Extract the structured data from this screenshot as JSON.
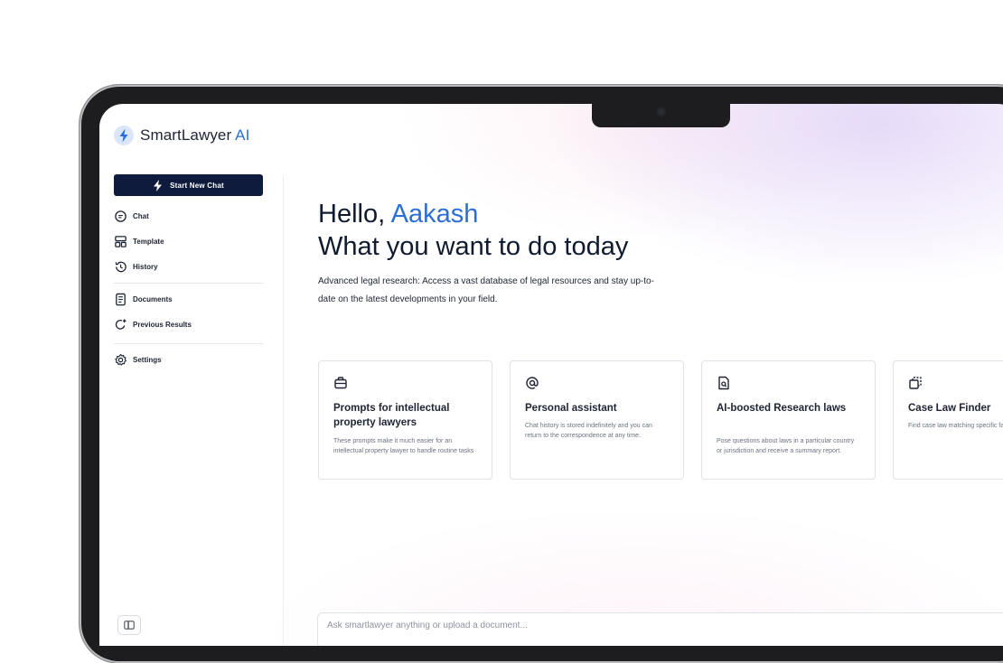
{
  "app": {
    "name_main": "SmartLawyer",
    "name_accent": "AI",
    "accent_color": "#2b6fd6",
    "primary_color": "#0e1b3d"
  },
  "sidebar": {
    "new_chat_label": "Start New Chat",
    "items": [
      {
        "label": "Chat",
        "icon": "chat-icon"
      },
      {
        "label": "Template",
        "icon": "template-icon"
      },
      {
        "label": "History",
        "icon": "history-icon"
      },
      {
        "label": "Documents",
        "icon": "document-icon"
      },
      {
        "label": "Previous Results",
        "icon": "refresh-sparkle-icon"
      },
      {
        "label": "Settings",
        "icon": "gear-icon"
      }
    ]
  },
  "main": {
    "greeting_prefix": "Hello, ",
    "user_name": "Aakash",
    "headline": "What you want to do today",
    "description": "Advanced legal research: Access a vast database of legal resources and stay up-to-date on the latest developments in your field.",
    "cards": [
      {
        "icon": "briefcase-icon",
        "title": "Prompts for intellectual property lawyers",
        "desc": "These prompts make it much easier for an intellectual property lawyer to handle routine tasks"
      },
      {
        "icon": "at-sign-icon",
        "title": "Personal assistant",
        "desc": "Chat history is stored indefinitely and you can return to the correspondence at any time."
      },
      {
        "icon": "file-search-icon",
        "title": "AI-boosted Research laws",
        "desc": "Pose questions about laws in a particular country or jurisdiction and receive a summary report."
      },
      {
        "icon": "copy-icon",
        "title": "Case Law Finder",
        "desc": "Find case law matching specific facts."
      }
    ],
    "input_placeholder": "Ask smartlawyer anything or upload a document..."
  }
}
